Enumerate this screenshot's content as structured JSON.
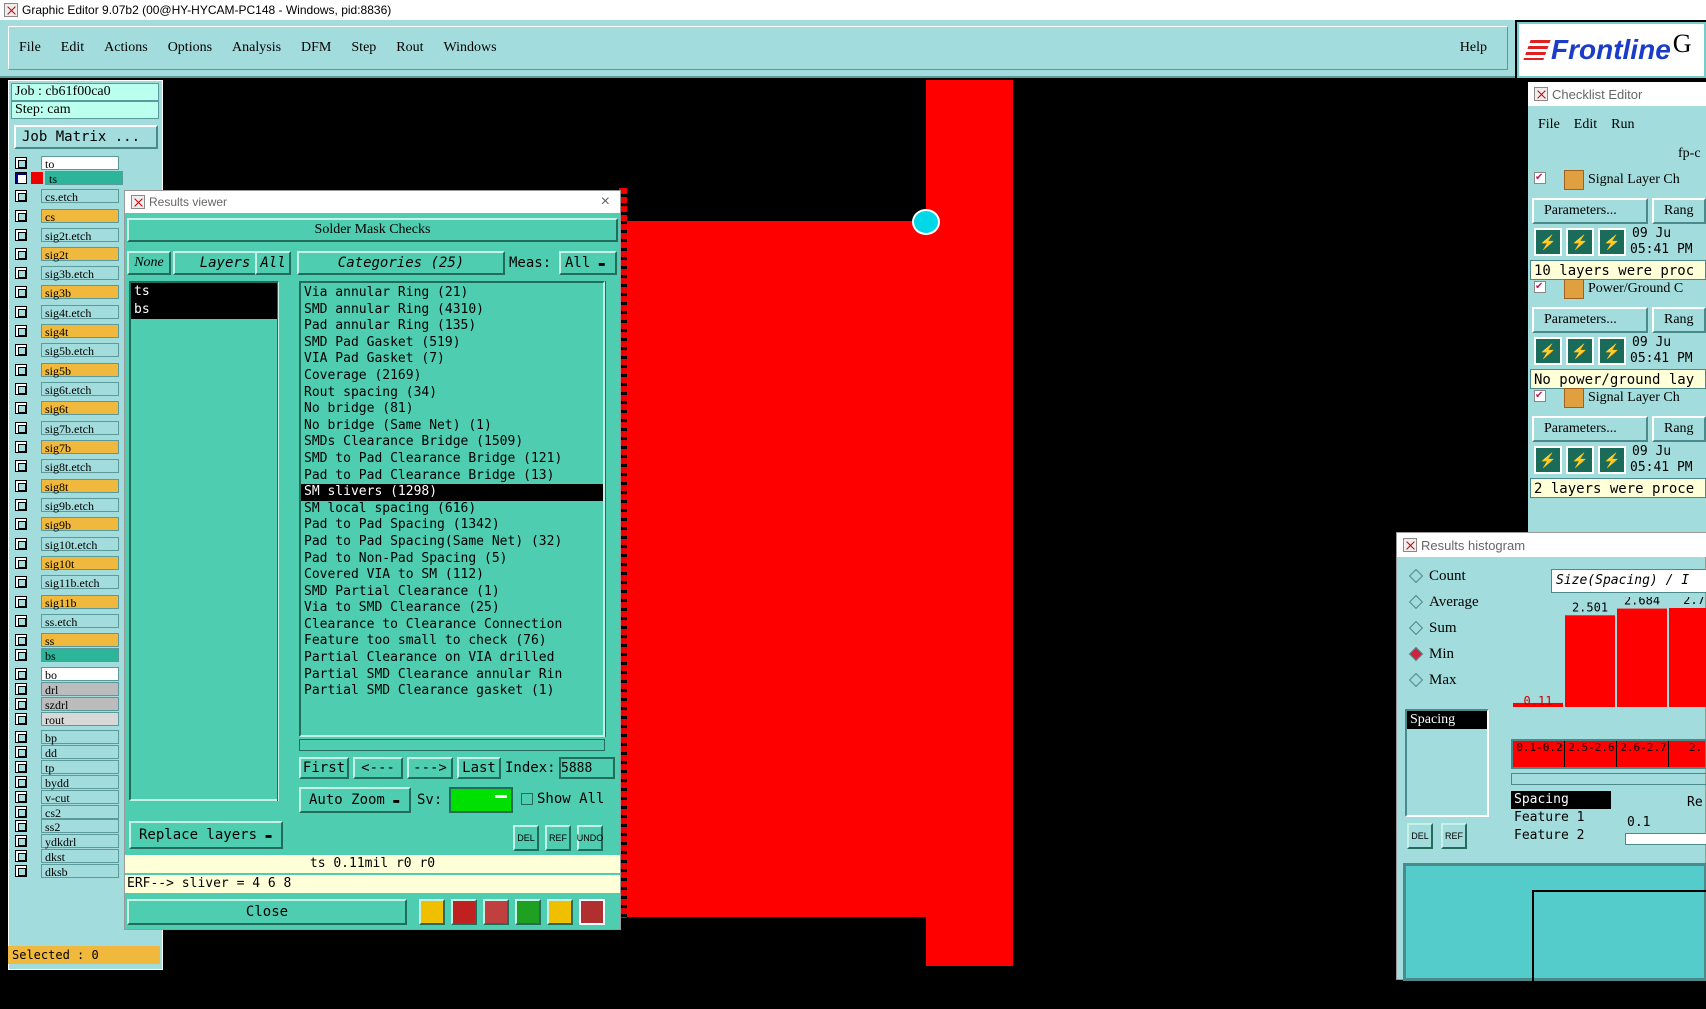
{
  "window": {
    "title": "Graphic Editor 9.07b2 (00@HY-HYCAM-PC148 - Windows, pid:8836)"
  },
  "menu": {
    "items": [
      "File",
      "Edit",
      "Actions",
      "Options",
      "Analysis",
      "DFM",
      "Step",
      "Rout",
      "Windows"
    ],
    "help": "Help"
  },
  "logo": {
    "text": "Frontline",
    "suffix": "G"
  },
  "left_panel": {
    "job": "Job : cb61f00ca0",
    "step": "Step: cam",
    "job_matrix": "Job Matrix ...",
    "layers": [
      {
        "name": "to",
        "color": "#ffffff"
      },
      {
        "name": "ts",
        "color": "#2db59a"
      },
      {
        "name": "cs.etch",
        "color": "#a3dcdc"
      },
      {
        "name": "cs",
        "color": "#f0b83c"
      },
      {
        "name": "sig2t.etch",
        "color": "#a3dcdc"
      },
      {
        "name": "sig2t",
        "color": "#f0b83c"
      },
      {
        "name": "sig3b.etch",
        "color": "#a3dcdc"
      },
      {
        "name": "sig3b",
        "color": "#f0b83c"
      },
      {
        "name": "sig4t.etch",
        "color": "#a3dcdc"
      },
      {
        "name": "sig4t",
        "color": "#f0b83c"
      },
      {
        "name": "sig5b.etch",
        "color": "#a3dcdc"
      },
      {
        "name": "sig5b",
        "color": "#f0b83c"
      },
      {
        "name": "sig6t.etch",
        "color": "#a3dcdc"
      },
      {
        "name": "sig6t",
        "color": "#f0b83c"
      },
      {
        "name": "sig7b.etch",
        "color": "#a3dcdc"
      },
      {
        "name": "sig7b",
        "color": "#f0b83c"
      },
      {
        "name": "sig8t.etch",
        "color": "#a3dcdc"
      },
      {
        "name": "sig8t",
        "color": "#f0b83c"
      },
      {
        "name": "sig9b.etch",
        "color": "#a3dcdc"
      },
      {
        "name": "sig9b",
        "color": "#f0b83c"
      },
      {
        "name": "sig10t.etch",
        "color": "#a3dcdc"
      },
      {
        "name": "sig10t",
        "color": "#f0b83c"
      },
      {
        "name": "sig11b.etch",
        "color": "#a3dcdc"
      },
      {
        "name": "sig11b",
        "color": "#f0b83c"
      },
      {
        "name": "ss.etch",
        "color": "#a3dcdc"
      },
      {
        "name": "ss",
        "color": "#f0b83c"
      },
      {
        "name": "bs",
        "color": "#2db59a"
      },
      {
        "name": "bo",
        "color": "#ffffff"
      },
      {
        "name": "drl",
        "color": "#bcbcbc"
      },
      {
        "name": "szdrl",
        "color": "#bcbcbc"
      },
      {
        "name": "rout",
        "color": "#d8d8d8"
      },
      {
        "name": "bp",
        "color": "#a3dcdc"
      },
      {
        "name": "dd",
        "color": "#a3dcdc"
      },
      {
        "name": "tp",
        "color": "#a3dcdc"
      },
      {
        "name": "bydd",
        "color": "#a3dcdc"
      },
      {
        "name": "v-cut",
        "color": "#a3dcdc"
      },
      {
        "name": "cs2",
        "color": "#a3dcdc"
      },
      {
        "name": "ss2",
        "color": "#a3dcdc"
      },
      {
        "name": "ydkdrl",
        "color": "#a3dcdc"
      },
      {
        "name": "dkst",
        "color": "#a3dcdc"
      },
      {
        "name": "dksb",
        "color": "#a3dcdc"
      }
    ],
    "selected": "Selected : 0"
  },
  "results_viewer": {
    "title": "Results viewer",
    "heading": "Solder Mask Checks",
    "none_btn": "None",
    "layers_btn": "Layers",
    "all_btn": "All",
    "layer_list": [
      "ts",
      "bs"
    ],
    "categories_btn": "Categories (25)",
    "meas_label": "Meas:",
    "meas_value": "All",
    "categories": [
      "Via annular Ring (21)",
      "SMD annular Ring (4310)",
      "Pad annular Ring (135)",
      "SMD Pad Gasket (519)",
      "VIA Pad Gasket (7)",
      "Coverage (2169)",
      "Rout spacing (34)",
      "No bridge (81)",
      "No bridge (Same Net) (1)",
      "SMDs Clearance Bridge (1509)",
      "SMD to Pad Clearance Bridge (121)",
      "Pad to Pad Clearance Bridge (13)",
      "SM slivers (1298)",
      "SM local spacing (616)",
      "Pad to Pad Spacing (1342)",
      "Pad to Pad Spacing(Same Net) (32)",
      "Pad to Non-Pad Spacing (5)",
      "Covered VIA to SM (112)",
      "SMD Partial Clearance (1)",
      "Via to SMD Clearance (25)",
      "Clearance to Clearance Connection",
      "Feature too small to check (76)",
      "Partial Clearance on VIA drilled",
      "Partial SMD Clearance annular Rin",
      "Partial SMD Clearance gasket (1)"
    ],
    "selected_category": "SM slivers (1298)",
    "nav": {
      "first": "First",
      "prev": "<---",
      "next": "--->",
      "last": "Last",
      "index_label": "Index:",
      "index_value": "5888"
    },
    "auto_zoom": "Auto Zoom",
    "sv_label": "Sv:",
    "show_all": "Show All",
    "replace_layers": "Replace layers",
    "tools": [
      "DEL",
      "REF",
      "UNDO"
    ],
    "status1": "ts 0.11mil  r0  r0",
    "status2": "ERF--> sliver = 4 6 8",
    "close": "Close"
  },
  "checklist_editor": {
    "title": "Checklist Editor",
    "menu": [
      "File",
      "Edit",
      "Run"
    ],
    "name": "fp-c",
    "checks": [
      {
        "label": "Signal Layer Ch",
        "params": "Parameters...",
        "range": "Rang",
        "date": "09 Ju",
        "time": "05:41 PM",
        "msg": "10 layers were proc"
      },
      {
        "label": "Power/Ground C",
        "params": "Parameters...",
        "range": "Rang",
        "date": "09 Ju",
        "time": "05:41 PM",
        "msg": "No power/ground lay"
      },
      {
        "label": "Signal Layer Ch",
        "params": "Parameters...",
        "range": "Rang",
        "date": "09 Ju",
        "time": "05:41 PM",
        "msg": "2 layers were proce"
      }
    ]
  },
  "results_histogram": {
    "title": "Results histogram",
    "options": [
      "Count",
      "Average",
      "Sum",
      "Min",
      "Max"
    ],
    "selected_option": "Min",
    "measure_list": [
      "Spacing"
    ],
    "header": "Size(Spacing) / I",
    "tools": [
      "DEL",
      "REF"
    ],
    "bottom_list": [
      "Spacing",
      "Feature 1",
      "Feature 2"
    ],
    "side_label": "Re",
    "side_value": "0.1"
  },
  "chart_data": {
    "type": "bar",
    "categories": [
      "0.1-0.2",
      "2.5-2.6",
      "2.6-2.7",
      "2."
    ],
    "values": [
      0.11,
      2.501,
      2.684,
      2.7
    ],
    "data_labels": [
      "0.11",
      "2.501",
      "2.684",
      "2.7"
    ]
  }
}
